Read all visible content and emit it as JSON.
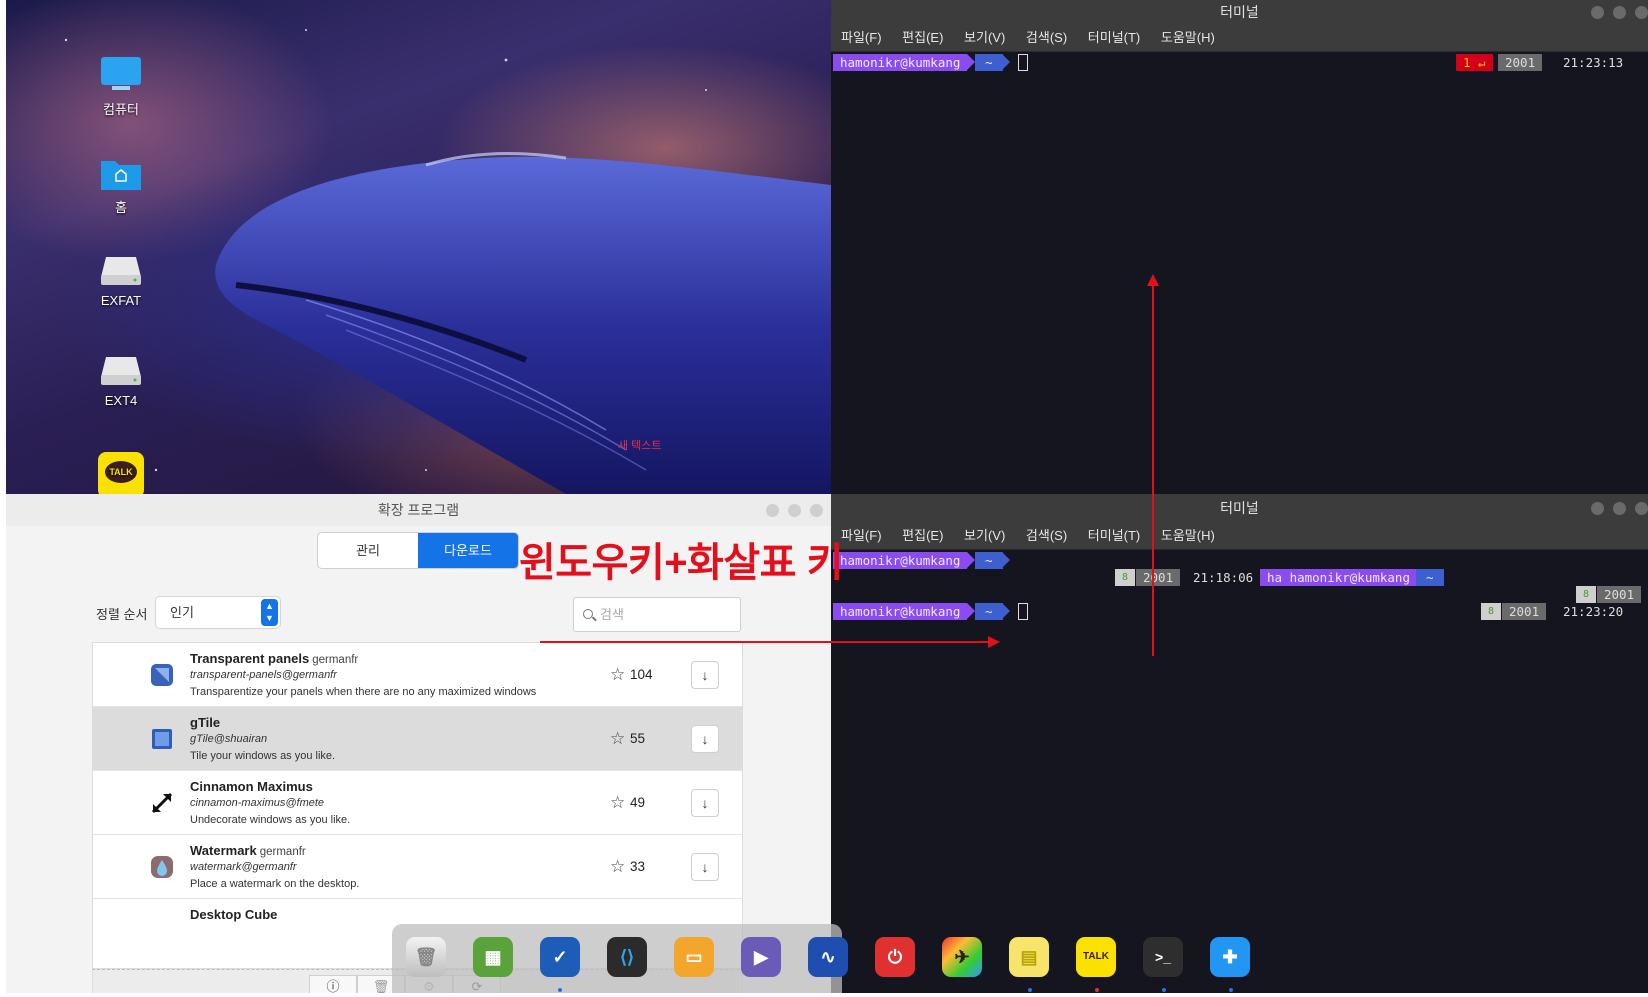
{
  "desktop": {
    "icons": [
      {
        "label": "컴퓨터",
        "icon": "computer-icon"
      },
      {
        "label": "홈",
        "icon": "home-folder-icon"
      },
      {
        "label": "EXFAT",
        "icon": "drive-icon"
      },
      {
        "label": "EXT4",
        "icon": "drive-icon"
      },
      {
        "label": "TALK",
        "icon": "kakaotalk-icon"
      }
    ],
    "stray_text": "새 텍스트"
  },
  "terminal_top": {
    "title": "터미널",
    "menu": [
      "파일(F)",
      "편집(E)",
      "보기(V)",
      "검색(S)",
      "터미널(T)",
      "도움말(H)"
    ],
    "prompt_user": "hamonikr@kumkang",
    "prompt_dir": "~",
    "status_exit": "1 ↵",
    "status_pid": "2001",
    "status_time": "21:23:13"
  },
  "terminal_bottom": {
    "title": "터미널",
    "menu": [
      "파일(F)",
      "편집(E)",
      "보기(V)",
      "검색(S)",
      "터미널(T)",
      "도움말(H)"
    ],
    "line1_user": "hamonikr@kumkang",
    "line1_dir": "~",
    "line2_jobs": "8",
    "line2_pid": "2001",
    "line2_time": "21:18:06",
    "line2_user": "ha hamonikr@kumkang",
    "line2_dir": "~",
    "line3_jobs": "8",
    "line3_pid": "2001",
    "line4_user": "hamonikr@kumkang",
    "line4_dir": "~",
    "line4_jobs": "8",
    "line4_pid": "2001",
    "line4_time": "21:23:20"
  },
  "extensions": {
    "title": "확장 프로그램",
    "tabs": [
      "관리",
      "다운로드"
    ],
    "active_tab": "다운로드",
    "sort_label": "정렬 순서",
    "sort_value": "인기",
    "search_placeholder": "검색",
    "items": [
      {
        "name": "Transparent panels",
        "author": "germanfr",
        "uuid": "transparent-panels@germanfr",
        "desc": "Transparentize your panels when there are no any maximized windows",
        "stars": "104",
        "icon": "transparent-panels-icon"
      },
      {
        "name": "gTile",
        "author": "",
        "uuid": "gTile@shuairan",
        "desc": "Tile your windows as you like.",
        "stars": "55",
        "icon": "gtile-icon"
      },
      {
        "name": "Cinnamon Maximus",
        "author": "",
        "uuid": "cinnamon-maximus@fmete",
        "desc": "Undecorate windows as you like.",
        "stars": "49",
        "icon": "maximize-arrows-icon"
      },
      {
        "name": "Watermark",
        "author": "germanfr",
        "uuid": "watermark@germanfr",
        "desc": "Place a watermark on the desktop.",
        "stars": "33",
        "icon": "watermark-drop-icon"
      }
    ],
    "partial_item": "Desktop Cube"
  },
  "overlay_annotation": "윈도우키+화살표 키",
  "dock": [
    {
      "name": "trash-icon"
    },
    {
      "name": "software-manager-icon"
    },
    {
      "name": "browser-icon"
    },
    {
      "name": "vscode-icon"
    },
    {
      "name": "files-icon"
    },
    {
      "name": "media-player-icon"
    },
    {
      "name": "system-monitor-icon"
    },
    {
      "name": "power-icon"
    },
    {
      "name": "rainbow-app-icon"
    },
    {
      "name": "sticky-notes-icon"
    },
    {
      "name": "kakaotalk-icon",
      "label": "TALK"
    },
    {
      "name": "terminal-icon",
      "label": ">_"
    },
    {
      "name": "extensions-puzzle-icon"
    }
  ],
  "colors": {
    "accent": "#1473e6",
    "annotation_red": "#e3101c",
    "prompt_user_bg": "#8a4cf0",
    "prompt_dir_bg": "#3d5fcf",
    "terminal_bg": "#15151f"
  }
}
